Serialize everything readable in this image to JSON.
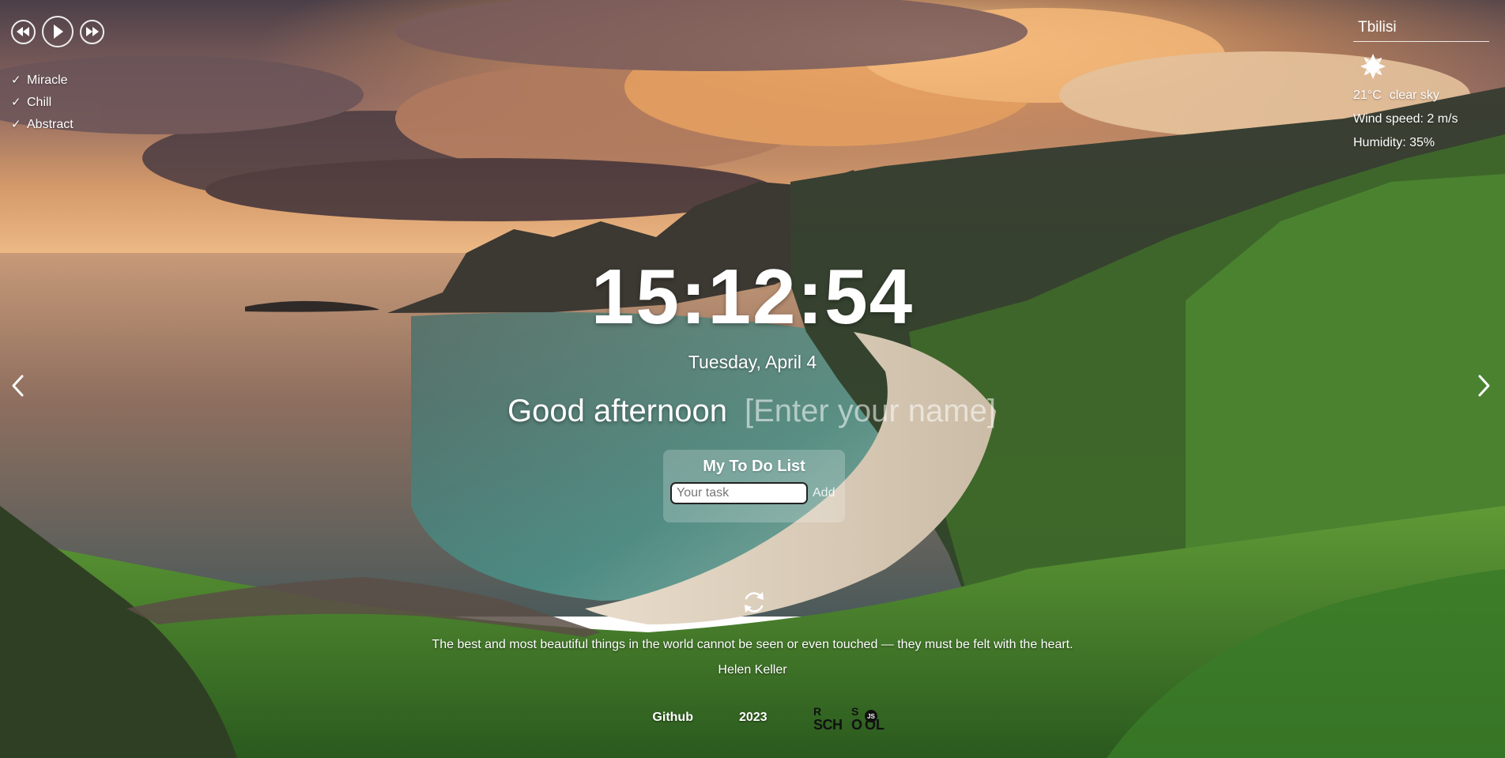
{
  "player": {
    "controls": [
      {
        "name": "prev-track-button",
        "icon": "rewind-icon"
      },
      {
        "name": "play-button",
        "icon": "play-icon"
      },
      {
        "name": "next-track-button",
        "icon": "fast-forward-icon"
      }
    ],
    "playlist": [
      {
        "title": "Miracle"
      },
      {
        "title": "Chill"
      },
      {
        "title": "Abstract"
      }
    ],
    "check_mark": "✓"
  },
  "weather": {
    "city": "Tbilisi",
    "icon": "sun-icon",
    "temperature": "21°C",
    "description": "clear sky",
    "wind": "Wind speed: 2 m/s",
    "humidity": "Humidity: 35%"
  },
  "slider": {
    "prev_icon": "chevron-left-icon",
    "next_icon": "chevron-right-icon"
  },
  "clock": {
    "time": "15:12:54",
    "date": "Tuesday, April 4"
  },
  "greeting": {
    "text": "Good afternoon",
    "name_placeholder": "[Enter your name]"
  },
  "todo": {
    "title": "My To Do List",
    "input_placeholder": "Your task",
    "add_label": "Add"
  },
  "quote": {
    "refresh_icon": "refresh-icon",
    "text": "The best and most beautiful things in the world cannot be seen or even touched — they must be felt with the heart.",
    "author": "Helen Keller"
  },
  "footer": {
    "github_label": "Github",
    "year": "2023",
    "logo_icon": "rs-school-logo",
    "logo_text": "RS SCHOOL"
  },
  "colors": {
    "text": "#ffffff",
    "todo_panel": "rgba(255,255,255,0.22)",
    "sky_top": "#5a4a52",
    "sunset": "#f0a55a",
    "sea": "#8a6a55",
    "grass": "#3f7a2a"
  }
}
